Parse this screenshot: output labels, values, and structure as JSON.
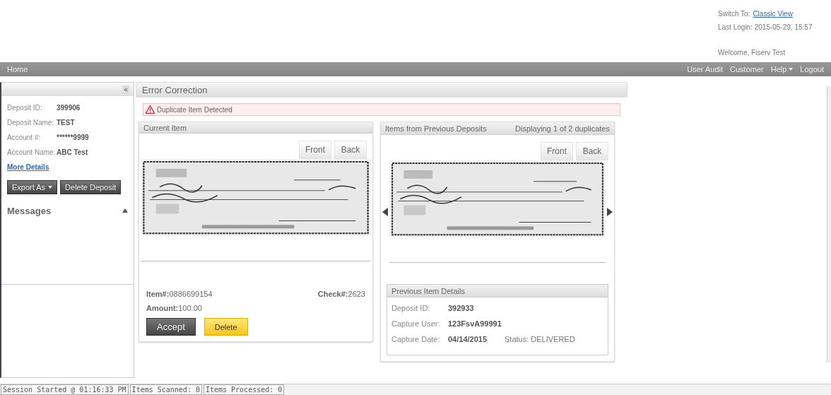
{
  "header": {
    "switch_label": "Switch To:",
    "switch_link": "Classic View",
    "last_login": "Last Login: 2015-05-29, 15:57",
    "welcome": "Welcome, Fiserv Test"
  },
  "nav": {
    "left": [
      "Home"
    ],
    "right": [
      {
        "label": "User Audit",
        "dropdown": false
      },
      {
        "label": "Customer",
        "dropdown": false
      },
      {
        "label": "Help",
        "dropdown": true
      },
      {
        "label": "Logout",
        "dropdown": false
      }
    ]
  },
  "sidebar": {
    "collapse": "«",
    "fields": [
      {
        "label": "Deposit ID:",
        "value": "399906"
      },
      {
        "label": "Deposit Name:",
        "value": "TEST"
      },
      {
        "label": "Account #:",
        "value": "******9999"
      },
      {
        "label": "Account Name:",
        "value": "ABC Test"
      }
    ],
    "link": "More Details",
    "buttons": [
      {
        "label": "Export As",
        "dropdown": true
      },
      {
        "label": "Delete Deposit",
        "dropdown": false
      }
    ],
    "messages": {
      "title": "Messages",
      "expanded": true
    }
  },
  "main": {
    "title": "Error Correction",
    "alert": "Duplicate Item Detected",
    "current": {
      "title": "Current Item",
      "tabs": [
        "Front",
        "Back"
      ],
      "item": {
        "label": "Item#:",
        "value": "0886699154"
      },
      "check": {
        "label": "Check#:",
        "value": "2623"
      },
      "amount": {
        "label": "Amount:",
        "value": "100.00"
      },
      "buttons": [
        {
          "label": "Accept",
          "kind": "dark"
        },
        {
          "label": "Delete",
          "kind": "yellow"
        }
      ]
    },
    "previous": {
      "title": "Items from Previous Deposits",
      "count": "Displaying 1 of 2 duplicates",
      "tabs": [
        "Front",
        "Back"
      ],
      "details": {
        "title": "Previous Item Details",
        "rows": [
          {
            "label": "Deposit ID:",
            "value": "392933"
          },
          {
            "label": "Capture User:",
            "value": "123FsvA99991"
          },
          {
            "label": "Capture Date:",
            "value": "04/14/2015",
            "extra": "Status: DELIVERED"
          }
        ]
      }
    }
  },
  "status_bar": [
    "Session Started @ 01:16:33 PM",
    "Items Scanned: 0",
    "Items Processed: 0"
  ]
}
